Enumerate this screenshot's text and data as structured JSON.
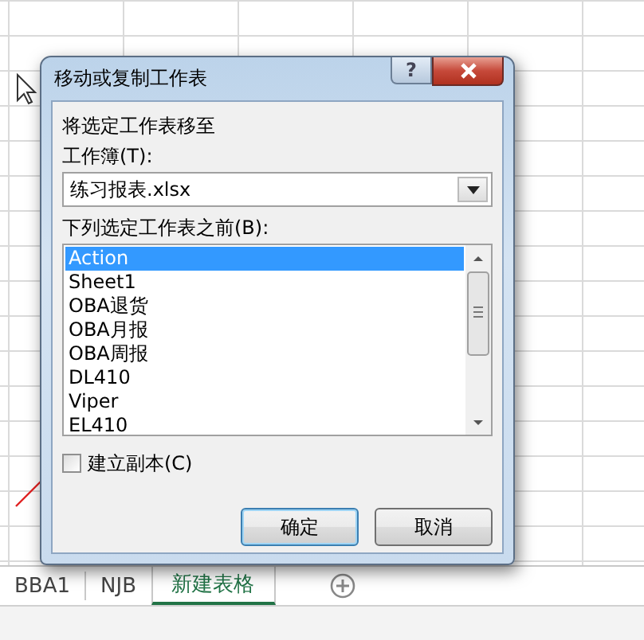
{
  "dialog": {
    "title": "移动或复制工作表",
    "help_button": "?",
    "move_label": "将选定工作表移至",
    "workbook_label": "工作簿(T):",
    "workbook": {
      "value": "练习报表.xlsx"
    },
    "before_label": "下列选定工作表之前(B):",
    "sheets": [
      {
        "label": "Action",
        "selected": true
      },
      {
        "label": "Sheet1",
        "selected": false
      },
      {
        "label": "OBA退货",
        "selected": false
      },
      {
        "label": "OBA月报",
        "selected": false
      },
      {
        "label": "OBA周报",
        "selected": false
      },
      {
        "label": "DL410",
        "selected": false
      },
      {
        "label": "Viper",
        "selected": false
      },
      {
        "label": "EL410",
        "selected": false
      }
    ],
    "copy_option": {
      "label": "建立副本(C)",
      "checked": false
    },
    "buttons": [
      {
        "label": "确定",
        "kind": "default"
      },
      {
        "label": "取消",
        "kind": "normal"
      }
    ]
  },
  "sheet_tabs": [
    {
      "label": "BBA1",
      "selected": false
    },
    {
      "label": "NJB",
      "selected": false
    },
    {
      "label": "新建表格",
      "selected": true
    }
  ]
}
